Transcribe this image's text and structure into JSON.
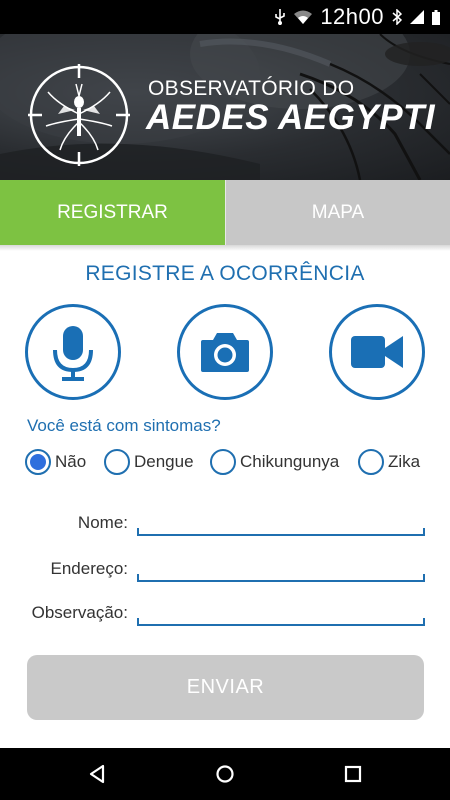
{
  "status_bar": {
    "time": "12h00",
    "icons": [
      "usb-icon",
      "wifi-icon",
      "bluetooth-icon",
      "signal-icon",
      "battery-icon"
    ]
  },
  "header": {
    "title_top": "OBSERVATÓRIO DO",
    "title_main": "AEDES AEGYPTI",
    "logo_icon": "mosquito-crosshair-icon"
  },
  "tabs": [
    {
      "label": "REGISTRAR",
      "active": true
    },
    {
      "label": "MAPA",
      "active": false
    }
  ],
  "section_title": "REGISTRE A OCORRÊNCIA",
  "media_buttons": [
    {
      "icon": "microphone-icon"
    },
    {
      "icon": "camera-icon"
    },
    {
      "icon": "video-camera-icon"
    }
  ],
  "symptoms": {
    "question": "Você está com sintomas?",
    "options": [
      "Não",
      "Dengue",
      "Chikungunya",
      "Zika"
    ],
    "selected": "Não"
  },
  "form": {
    "name_label": "Nome:",
    "name_value": "",
    "address_label": "Endereço:",
    "address_value": "",
    "notes_label": "Observação:",
    "notes_value": ""
  },
  "submit_label": "ENVIAR",
  "nav_bar": {
    "icons": [
      "back-triangle-icon",
      "home-circle-icon",
      "recents-square-icon"
    ]
  },
  "colors": {
    "accent_blue": "#1f6fb0",
    "tab_active_green": "#7dc242",
    "tab_inactive_gray": "#c7c7c7",
    "button_disabled_gray": "#c9c9c9",
    "header_dark": "#2a2d31"
  }
}
